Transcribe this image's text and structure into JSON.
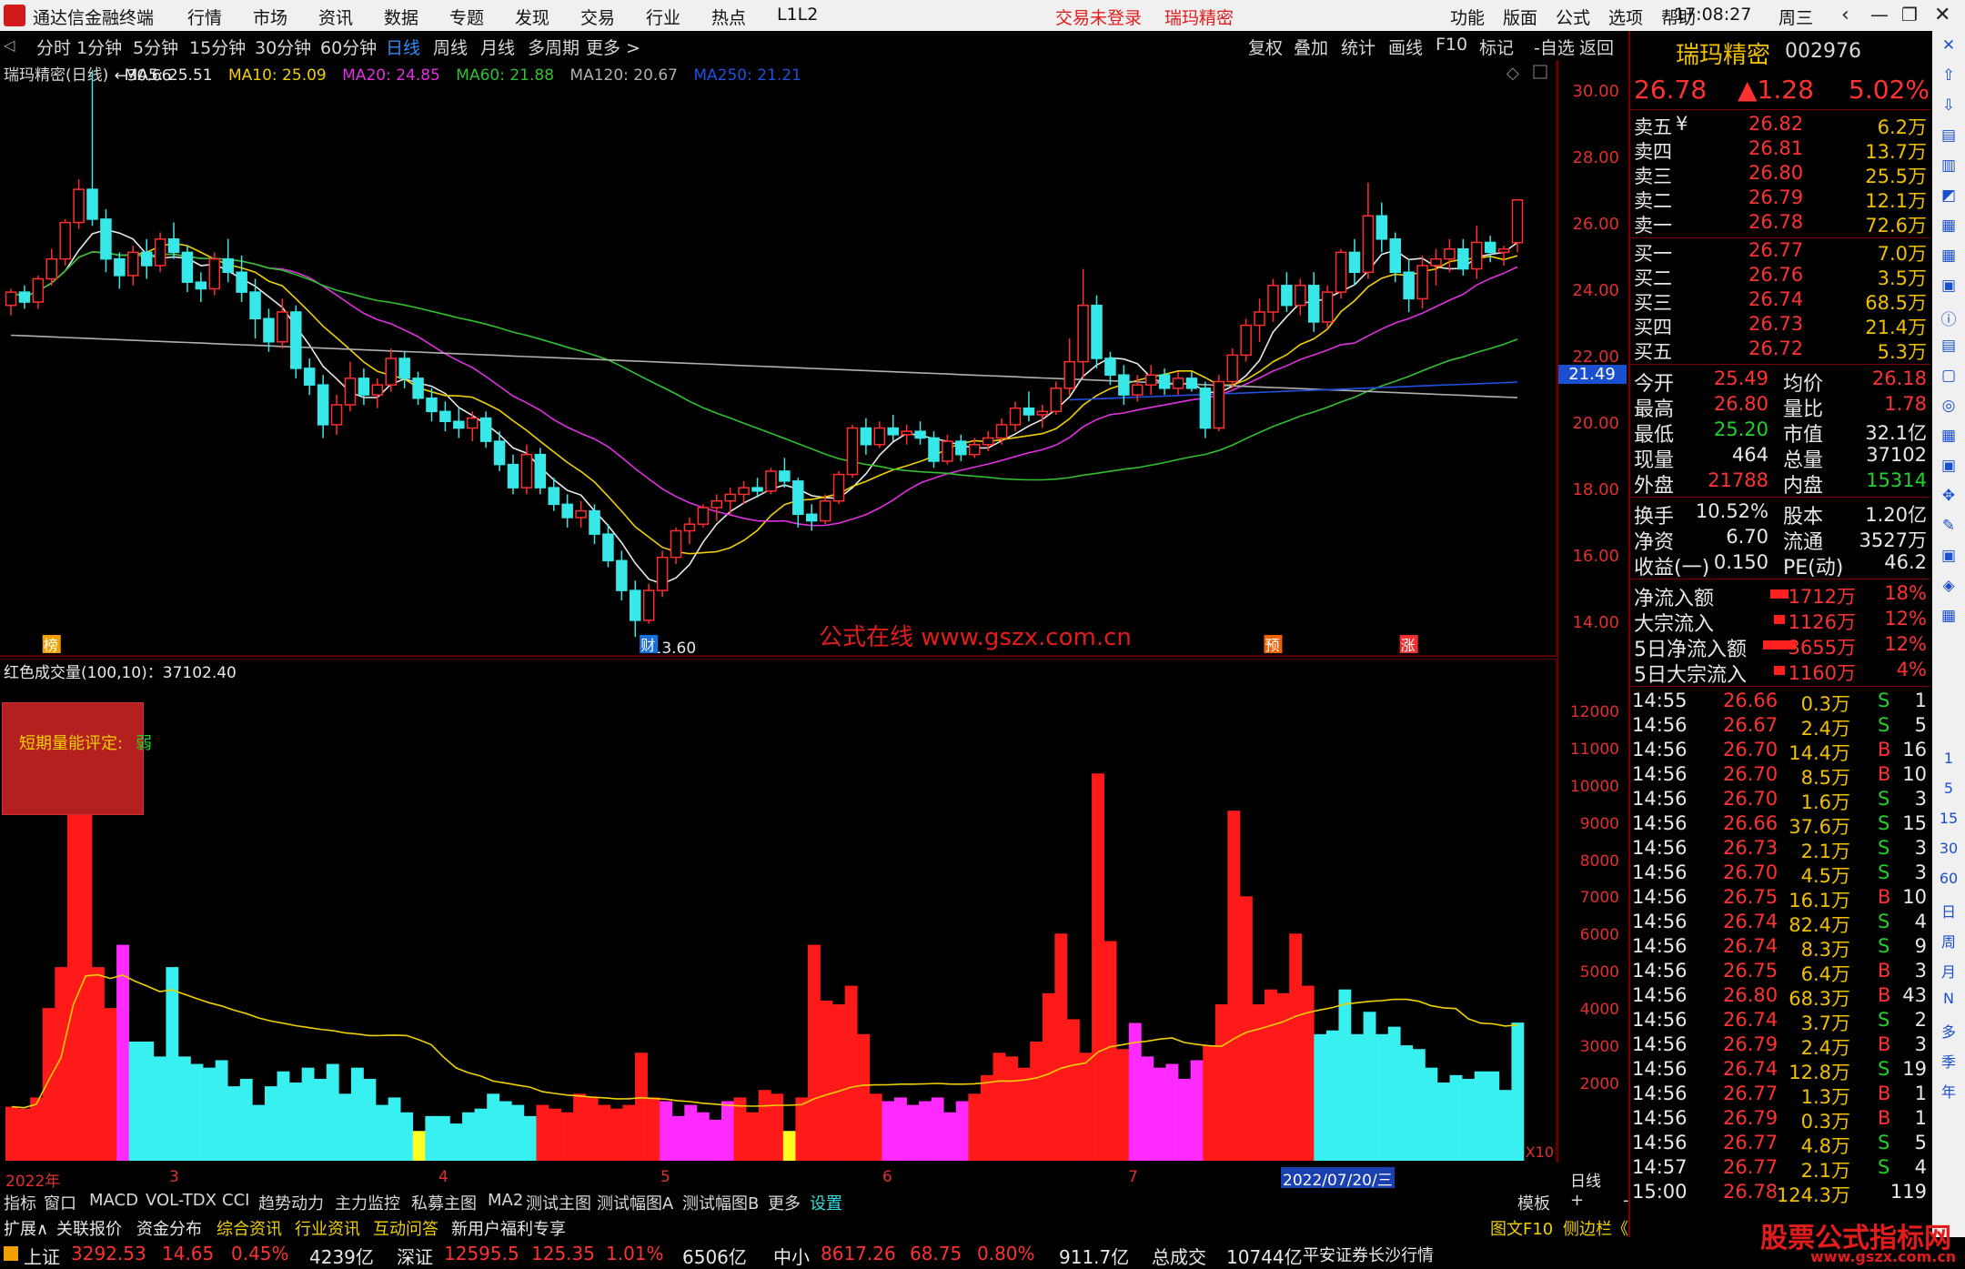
{
  "titlebar": {
    "app_name": "通达信金融终端",
    "menus": [
      "行情",
      "市场",
      "资讯",
      "数据",
      "专题",
      "发现",
      "交易",
      "行业",
      "热点",
      "L1L2"
    ],
    "status": "交易未登录",
    "stock": "瑞玛精密",
    "right_menus": [
      "功能",
      "版面",
      "公式",
      "选项",
      "帮助"
    ],
    "time": "17:08:27",
    "weekday": "周三"
  },
  "periods": [
    "分时",
    "1分钟",
    "5分钟",
    "15分钟",
    "30分钟",
    "60分钟",
    "日线",
    "周线",
    "月线",
    "多周期",
    "更多 >"
  ],
  "active_period": "日线",
  "tools": [
    "复权",
    "叠加",
    "统计",
    "画线",
    "F10",
    "标记",
    "-自选",
    "返回"
  ],
  "chart_header": {
    "name": "瑞玛精密(日线)",
    "ma5": "MA5: 25.51",
    "ma10": "MA10: 25.09",
    "ma20": "MA20: 24.85",
    "ma60": "MA60: 21.88",
    "ma120": "MA120: 20.67",
    "ma250": "MA250: 21.21"
  },
  "price_axis": [
    "30.00",
    "28.00",
    "26.00",
    "24.00",
    "22.00",
    "20.00",
    "18.00",
    "16.00",
    "14.00"
  ],
  "price_annotations": {
    "high": "30.66",
    "low": "13.60",
    "current_line": "21.49"
  },
  "markers": [
    "榜",
    "财",
    "预",
    "涨"
  ],
  "volume_header": "红色成交量(100,10)：37102.40",
  "volume_axis": [
    "12000",
    "11000",
    "10000",
    "9000",
    "8000",
    "7000",
    "6000",
    "5000",
    "4000",
    "3000",
    "2000"
  ],
  "volume_unit": "X10",
  "rating": {
    "label": "短期量能评定:",
    "value": "弱"
  },
  "x_axis": {
    "labels": [
      "2022年",
      "3",
      "4",
      "5",
      "6",
      "7"
    ],
    "cursor_date": "2022/07/20/三",
    "period": "日线"
  },
  "watermark": "公式在线  www.gszx.com.cn",
  "bottom_tabs": [
    "指标",
    "窗口",
    "MACD",
    "VOL-TDX",
    "CCI",
    "趋势动力",
    "主力监控",
    "私募主图",
    "MA2",
    "测试主图",
    "测试幅图A",
    "测试幅图B",
    "更多",
    "设置"
  ],
  "bottom_tabs_right": [
    "模板",
    "+",
    "-"
  ],
  "infobar": [
    "扩展∧",
    "关联报价",
    "资金分布",
    "综合资讯",
    "行业资讯",
    "互动问答",
    "新用户福利专享"
  ],
  "infobar_right": [
    "图文F10",
    "侧边栏《",
    "笔",
    "价",
    "细",
    "势"
  ],
  "tickers": {
    "sh": {
      "name": "上证",
      "value": "3292.53",
      "change": "14.65",
      "pct": "0.45%",
      "amount": "4239亿"
    },
    "sz": {
      "name": "深证",
      "value": "12595.5",
      "change": "125.35",
      "pct": "1.01%",
      "amount": "6506亿"
    },
    "zx": {
      "name": "中小",
      "value": "8617.26",
      "change": "68.75",
      "pct": "0.80%",
      "amount": "911.7亿"
    },
    "total": {
      "label": "总成交",
      "value": "10744亿",
      "broker": "平安证券长沙行情"
    }
  },
  "quote": {
    "name": "瑞玛精密",
    "code": "002976",
    "price": "26.78",
    "change": "▲1.28",
    "pct": "5.02%",
    "asks": [
      {
        "label": "卖五",
        "flag": "¥",
        "price": "26.82",
        "vol": "6.2万"
      },
      {
        "label": "卖四",
        "flag": "",
        "price": "26.81",
        "vol": "13.7万"
      },
      {
        "label": "卖三",
        "flag": "",
        "price": "26.80",
        "vol": "25.5万"
      },
      {
        "label": "卖二",
        "flag": "",
        "price": "26.79",
        "vol": "12.1万"
      },
      {
        "label": "卖一",
        "flag": "",
        "price": "26.78",
        "vol": "72.6万"
      }
    ],
    "bids": [
      {
        "label": "买一",
        "price": "26.77",
        "vol": "7.0万"
      },
      {
        "label": "买二",
        "price": "26.76",
        "vol": "3.5万"
      },
      {
        "label": "买三",
        "price": "26.74",
        "vol": "68.5万"
      },
      {
        "label": "买四",
        "price": "26.73",
        "vol": "21.4万"
      },
      {
        "label": "买五",
        "price": "26.72",
        "vol": "5.3万"
      }
    ],
    "stats1": [
      {
        "k1": "今开",
        "v1": "25.49",
        "k2": "均价",
        "v2": "26.18"
      },
      {
        "k1": "最高",
        "v1": "26.80",
        "k2": "量比",
        "v2": "1.78"
      },
      {
        "k1": "最低",
        "v1": "25.20",
        "k2": "市值",
        "v2": "32.1亿"
      },
      {
        "k1": "现量",
        "v1": "464",
        "k2": "总量",
        "v2": "37102"
      },
      {
        "k1": "外盘",
        "v1": "21788",
        "k2": "内盘",
        "v2": "15314"
      }
    ],
    "stats2": [
      {
        "k1": "换手",
        "v1": "10.52%",
        "k2": "股本",
        "v2": "1.20亿"
      },
      {
        "k1": "净资",
        "v1": "6.70",
        "k2": "流通",
        "v2": "3527万"
      },
      {
        "k1": "收益(一)",
        "v1": "0.150",
        "k2": "PE(动)",
        "v2": "46.2"
      }
    ],
    "flows": [
      {
        "label": "净流入额",
        "value": "1712万",
        "pct": "18%"
      },
      {
        "label": "大宗流入",
        "value": "1126万",
        "pct": "12%"
      },
      {
        "label": "5日净流入额",
        "value": "3655万",
        "pct": "12%"
      },
      {
        "label": "5日大宗流入",
        "value": "1160万",
        "pct": "4%"
      }
    ],
    "ticks": [
      {
        "t": "14:55",
        "p": "26.66",
        "v": "0.3万",
        "s": "S",
        "n": "1"
      },
      {
        "t": "14:56",
        "p": "26.67",
        "v": "2.4万",
        "s": "S",
        "n": "5"
      },
      {
        "t": "14:56",
        "p": "26.70",
        "v": "14.4万",
        "s": "B",
        "n": "16"
      },
      {
        "t": "14:56",
        "p": "26.70",
        "v": "8.5万",
        "s": "B",
        "n": "10"
      },
      {
        "t": "14:56",
        "p": "26.70",
        "v": "1.6万",
        "s": "S",
        "n": "3"
      },
      {
        "t": "14:56",
        "p": "26.66",
        "v": "37.6万",
        "s": "S",
        "n": "15"
      },
      {
        "t": "14:56",
        "p": "26.73",
        "v": "2.1万",
        "s": "S",
        "n": "3"
      },
      {
        "t": "14:56",
        "p": "26.70",
        "v": "4.5万",
        "s": "S",
        "n": "3"
      },
      {
        "t": "14:56",
        "p": "26.75",
        "v": "16.1万",
        "s": "B",
        "n": "10"
      },
      {
        "t": "14:56",
        "p": "26.74",
        "v": "82.4万",
        "s": "S",
        "n": "4"
      },
      {
        "t": "14:56",
        "p": "26.74",
        "v": "8.3万",
        "s": "S",
        "n": "9"
      },
      {
        "t": "14:56",
        "p": "26.75",
        "v": "6.4万",
        "s": "B",
        "n": "3"
      },
      {
        "t": "14:56",
        "p": "26.80",
        "v": "68.3万",
        "s": "B",
        "n": "43"
      },
      {
        "t": "14:56",
        "p": "26.74",
        "v": "3.7万",
        "s": "S",
        "n": "2"
      },
      {
        "t": "14:56",
        "p": "26.79",
        "v": "2.4万",
        "s": "B",
        "n": "3"
      },
      {
        "t": "14:56",
        "p": "26.74",
        "v": "12.8万",
        "s": "S",
        "n": "19"
      },
      {
        "t": "14:56",
        "p": "26.77",
        "v": "1.3万",
        "s": "B",
        "n": "1"
      },
      {
        "t": "14:56",
        "p": "26.79",
        "v": "0.3万",
        "s": "B",
        "n": "1"
      },
      {
        "t": "14:56",
        "p": "26.77",
        "v": "4.8万",
        "s": "S",
        "n": "5"
      },
      {
        "t": "14:57",
        "p": "26.77",
        "v": "2.1万",
        "s": "S",
        "n": "4"
      },
      {
        "t": "15:00",
        "p": "26.78",
        "v": "124.3万",
        "s": "",
        "n": "119"
      }
    ]
  },
  "sidebar_icons": [
    "close-icon",
    "up-icon",
    "down-icon",
    "quote-icon",
    "list-icon",
    "chart-icon",
    "kline-icon",
    "table-icon",
    "f10-icon",
    "info-icon",
    "notes-icon",
    "f2-icon",
    "circle-icon",
    "grid-icon",
    "rsi-icon",
    "move-icon",
    "pen-icon",
    "fs-icon",
    "share-icon",
    "period-icons"
  ],
  "sidebar_periods": [
    "1",
    "5",
    "15",
    "30",
    "60",
    "日",
    "周",
    "月",
    "N",
    "多",
    "季",
    "年"
  ],
  "brand_watermark": "股票公式指标网",
  "brand_url": "www.gszx.com.cn",
  "candles": [
    [
      23.6,
      24.1,
      23.3,
      24.0
    ],
    [
      24.0,
      24.2,
      23.5,
      23.7
    ],
    [
      23.7,
      24.5,
      23.5,
      24.4
    ],
    [
      24.4,
      25.3,
      24.2,
      25.0
    ],
    [
      25.0,
      26.2,
      24.8,
      26.1
    ],
    [
      26.1,
      27.4,
      25.9,
      27.1
    ],
    [
      27.1,
      30.66,
      26.0,
      26.2
    ],
    [
      26.2,
      26.5,
      24.6,
      25.0
    ],
    [
      25.0,
      25.2,
      24.1,
      24.5
    ],
    [
      24.5,
      25.4,
      24.2,
      25.2
    ],
    [
      25.2,
      25.6,
      24.4,
      24.8
    ],
    [
      24.8,
      25.8,
      24.6,
      25.6
    ],
    [
      25.6,
      26.1,
      25.0,
      25.2
    ],
    [
      25.2,
      25.4,
      24.0,
      24.3
    ],
    [
      24.3,
      24.6,
      23.7,
      24.1
    ],
    [
      24.1,
      25.2,
      23.9,
      25.0
    ],
    [
      25.0,
      25.6,
      24.3,
      24.6
    ],
    [
      24.6,
      25.1,
      23.7,
      24.0
    ],
    [
      24.0,
      24.4,
      22.6,
      23.2
    ],
    [
      23.2,
      23.5,
      22.2,
      22.5
    ],
    [
      22.5,
      23.8,
      22.3,
      23.4
    ],
    [
      23.4,
      23.6,
      21.4,
      21.7
    ],
    [
      21.7,
      22.0,
      20.9,
      21.2
    ],
    [
      21.2,
      21.5,
      19.6,
      20.0
    ],
    [
      20.0,
      20.9,
      19.7,
      20.6
    ],
    [
      20.6,
      21.9,
      20.4,
      21.4
    ],
    [
      21.4,
      21.7,
      20.6,
      20.9
    ],
    [
      20.9,
      21.4,
      20.5,
      21.2
    ],
    [
      21.2,
      22.3,
      21.0,
      22.0
    ],
    [
      22.0,
      22.2,
      21.1,
      21.4
    ],
    [
      21.4,
      21.6,
      20.6,
      20.8
    ],
    [
      20.8,
      21.1,
      20.1,
      20.4
    ],
    [
      20.4,
      20.7,
      19.8,
      20.1
    ],
    [
      20.1,
      20.5,
      19.6,
      19.9
    ],
    [
      19.9,
      20.4,
      19.5,
      20.2
    ],
    [
      20.2,
      20.4,
      19.3,
      19.5
    ],
    [
      19.5,
      19.8,
      18.6,
      18.8
    ],
    [
      18.8,
      19.1,
      17.9,
      18.1
    ],
    [
      18.1,
      19.4,
      17.9,
      19.1
    ],
    [
      19.1,
      19.3,
      17.9,
      18.1
    ],
    [
      18.1,
      18.4,
      17.4,
      17.6
    ],
    [
      17.6,
      17.9,
      16.9,
      17.2
    ],
    [
      17.2,
      17.7,
      16.9,
      17.4
    ],
    [
      17.4,
      17.6,
      16.4,
      16.7
    ],
    [
      16.7,
      17.0,
      15.7,
      15.9
    ],
    [
      15.9,
      16.2,
      14.7,
      15.0
    ],
    [
      15.0,
      15.3,
      13.6,
      14.1
    ],
    [
      14.1,
      15.2,
      14.0,
      15.0
    ],
    [
      15.0,
      16.2,
      14.8,
      16.0
    ],
    [
      16.0,
      16.9,
      15.8,
      16.8
    ],
    [
      16.8,
      17.2,
      16.4,
      17.0
    ],
    [
      17.0,
      17.6,
      16.9,
      17.5
    ],
    [
      17.5,
      17.9,
      17.1,
      17.7
    ],
    [
      17.7,
      18.1,
      17.3,
      17.9
    ],
    [
      17.9,
      18.3,
      17.6,
      18.1
    ],
    [
      18.1,
      18.4,
      17.8,
      18.0
    ],
    [
      18.0,
      18.7,
      17.9,
      18.6
    ],
    [
      18.6,
      19.0,
      18.1,
      18.3
    ],
    [
      18.3,
      18.4,
      16.9,
      17.3
    ],
    [
      17.3,
      17.6,
      16.8,
      17.1
    ],
    [
      17.1,
      17.9,
      17.0,
      17.7
    ],
    [
      17.7,
      18.6,
      17.6,
      18.5
    ],
    [
      18.5,
      20.0,
      18.4,
      19.9
    ],
    [
      19.9,
      20.2,
      19.1,
      19.4
    ],
    [
      19.4,
      20.1,
      19.3,
      19.9
    ],
    [
      19.9,
      20.3,
      19.5,
      19.7
    ],
    [
      19.7,
      20.0,
      19.4,
      19.8
    ],
    [
      19.8,
      20.1,
      19.4,
      19.6
    ],
    [
      19.6,
      19.8,
      18.7,
      18.9
    ],
    [
      18.9,
      19.7,
      18.8,
      19.5
    ],
    [
      19.5,
      19.7,
      18.9,
      19.1
    ],
    [
      19.1,
      19.6,
      19.0,
      19.4
    ],
    [
      19.4,
      19.8,
      19.2,
      19.6
    ],
    [
      19.6,
      20.2,
      19.4,
      20.0
    ],
    [
      20.0,
      20.7,
      19.8,
      20.5
    ],
    [
      20.5,
      21.0,
      20.1,
      20.3
    ],
    [
      20.3,
      20.6,
      19.9,
      20.4
    ],
    [
      20.4,
      21.3,
      20.3,
      21.1
    ],
    [
      21.1,
      22.6,
      20.9,
      21.9
    ],
    [
      21.9,
      24.7,
      21.4,
      23.6
    ],
    [
      23.6,
      23.9,
      21.7,
      22.0
    ],
    [
      22.0,
      22.2,
      21.2,
      21.5
    ],
    [
      21.5,
      21.8,
      20.6,
      20.9
    ],
    [
      20.9,
      21.5,
      20.7,
      21.2
    ],
    [
      21.2,
      21.8,
      20.9,
      21.5
    ],
    [
      21.5,
      21.7,
      20.9,
      21.1
    ],
    [
      21.1,
      21.6,
      20.9,
      21.4
    ],
    [
      21.4,
      21.6,
      21.0,
      21.1
    ],
    [
      21.1,
      21.3,
      19.6,
      19.9
    ],
    [
      19.9,
      21.5,
      19.8,
      21.3
    ],
    [
      21.3,
      22.3,
      21.1,
      22.1
    ],
    [
      22.1,
      23.2,
      21.9,
      23.0
    ],
    [
      23.0,
      23.8,
      22.5,
      23.4
    ],
    [
      23.4,
      24.4,
      23.1,
      24.2
    ],
    [
      24.2,
      24.6,
      23.4,
      23.6
    ],
    [
      23.6,
      24.4,
      23.3,
      24.2
    ],
    [
      24.2,
      24.6,
      22.8,
      23.1
    ],
    [
      23.1,
      24.2,
      22.9,
      24.0
    ],
    [
      24.0,
      25.3,
      23.8,
      25.2
    ],
    [
      25.2,
      25.6,
      24.2,
      24.6
    ],
    [
      24.6,
      27.3,
      24.4,
      26.3
    ],
    [
      26.3,
      26.7,
      25.2,
      25.6
    ],
    [
      25.6,
      25.8,
      24.3,
      24.6
    ],
    [
      24.6,
      25.0,
      23.4,
      23.8
    ],
    [
      23.8,
      25.1,
      23.5,
      24.8
    ],
    [
      24.8,
      25.3,
      24.2,
      25.0
    ],
    [
      25.0,
      25.6,
      24.6,
      25.3
    ],
    [
      25.3,
      25.6,
      24.5,
      24.7
    ],
    [
      24.7,
      26.0,
      24.4,
      25.5
    ],
    [
      25.5,
      25.7,
      24.9,
      25.2
    ],
    [
      25.2,
      25.4,
      24.8,
      25.3
    ],
    [
      25.49,
      26.8,
      25.2,
      26.78
    ]
  ],
  "volumes": [
    [
      1450,
      "red"
    ],
    [
      1400,
      "red"
    ],
    [
      1700,
      "red"
    ],
    [
      4100,
      "red"
    ],
    [
      5200,
      "red"
    ],
    [
      11300,
      "red"
    ],
    [
      9600,
      "red"
    ],
    [
      5200,
      "red"
    ],
    [
      4100,
      "red"
    ],
    [
      5800,
      "magenta"
    ],
    [
      3200,
      "cyan"
    ],
    [
      3200,
      "cyan"
    ],
    [
      2800,
      "cyan"
    ],
    [
      5200,
      "cyan"
    ],
    [
      2800,
      "cyan"
    ],
    [
      2600,
      "cyan"
    ],
    [
      2500,
      "cyan"
    ],
    [
      2700,
      "cyan"
    ],
    [
      2000,
      "cyan"
    ],
    [
      2200,
      "cyan"
    ],
    [
      1500,
      "cyan"
    ],
    [
      2000,
      "cyan"
    ],
    [
      2400,
      "cyan"
    ],
    [
      2100,
      "cyan"
    ],
    [
      2500,
      "cyan"
    ],
    [
      2200,
      "cyan"
    ],
    [
      2600,
      "cyan"
    ],
    [
      1800,
      "cyan"
    ],
    [
      2500,
      "cyan"
    ],
    [
      2200,
      "cyan"
    ],
    [
      1500,
      "cyan"
    ],
    [
      1700,
      "cyan"
    ],
    [
      1300,
      "cyan"
    ],
    [
      800,
      "yellow"
    ],
    [
      1200,
      "cyan"
    ],
    [
      1200,
      "cyan"
    ],
    [
      1000,
      "cyan"
    ],
    [
      1300,
      "cyan"
    ],
    [
      1400,
      "cyan"
    ],
    [
      1800,
      "cyan"
    ],
    [
      1600,
      "cyan"
    ],
    [
      1500,
      "cyan"
    ],
    [
      1200,
      "cyan"
    ],
    [
      1500,
      "red"
    ],
    [
      1400,
      "red"
    ],
    [
      1300,
      "red"
    ],
    [
      1800,
      "red"
    ],
    [
      1700,
      "red"
    ],
    [
      1500,
      "red"
    ],
    [
      1400,
      "red"
    ],
    [
      1500,
      "red"
    ],
    [
      2900,
      "red"
    ],
    [
      1700,
      "red"
    ],
    [
      1600,
      "magenta"
    ],
    [
      1200,
      "magenta"
    ],
    [
      1500,
      "magenta"
    ],
    [
      1300,
      "magenta"
    ],
    [
      1100,
      "magenta"
    ],
    [
      1600,
      "magenta"
    ],
    [
      1700,
      "red"
    ],
    [
      1300,
      "red"
    ],
    [
      1900,
      "red"
    ],
    [
      1800,
      "red"
    ],
    [
      800,
      "yellow"
    ],
    [
      1700,
      "red"
    ],
    [
      5800,
      "red"
    ],
    [
      4300,
      "red"
    ],
    [
      4200,
      "red"
    ],
    [
      4700,
      "red"
    ],
    [
      3400,
      "red"
    ],
    [
      1800,
      "red"
    ],
    [
      1600,
      "magenta"
    ],
    [
      1700,
      "magenta"
    ],
    [
      1500,
      "magenta"
    ],
    [
      1600,
      "magenta"
    ],
    [
      1700,
      "magenta"
    ],
    [
      1300,
      "magenta"
    ],
    [
      1600,
      "magenta"
    ],
    [
      1800,
      "red"
    ],
    [
      2300,
      "red"
    ],
    [
      2900,
      "red"
    ],
    [
      2800,
      "red"
    ],
    [
      2500,
      "red"
    ],
    [
      3200,
      "red"
    ],
    [
      4500,
      "red"
    ],
    [
      6100,
      "red"
    ],
    [
      3800,
      "red"
    ],
    [
      2900,
      "red"
    ],
    [
      10400,
      "red"
    ],
    [
      5900,
      "red"
    ],
    [
      3000,
      "red"
    ],
    [
      3700,
      "magenta"
    ],
    [
      2800,
      "magenta"
    ],
    [
      2500,
      "magenta"
    ],
    [
      2600,
      "magenta"
    ],
    [
      2200,
      "magenta"
    ],
    [
      2700,
      "magenta"
    ],
    [
      3100,
      "red"
    ],
    [
      4200,
      "red"
    ],
    [
      9400,
      "red"
    ],
    [
      7100,
      "red"
    ],
    [
      4200,
      "red"
    ],
    [
      4600,
      "red"
    ],
    [
      4500,
      "red"
    ],
    [
      6100,
      "red"
    ],
    [
      4700,
      "red"
    ],
    [
      3400,
      "cyan"
    ],
    [
      3500,
      "cyan"
    ],
    [
      4600,
      "cyan"
    ],
    [
      3400,
      "cyan"
    ],
    [
      4000,
      "cyan"
    ],
    [
      3400,
      "cyan"
    ],
    [
      3600,
      "cyan"
    ],
    [
      3100,
      "cyan"
    ],
    [
      3000,
      "cyan"
    ],
    [
      2500,
      "cyan"
    ],
    [
      2100,
      "cyan"
    ],
    [
      2300,
      "cyan"
    ],
    [
      2200,
      "cyan"
    ],
    [
      2400,
      "cyan"
    ],
    [
      2400,
      "cyan"
    ],
    [
      1900,
      "cyan"
    ],
    [
      3710,
      "cyan"
    ]
  ],
  "colors": {
    "up": "#ff2d2d",
    "down": "#38e8e8",
    "ma5": "#e8e8e8",
    "ma10": "#f0d000",
    "ma20": "#e030e0",
    "ma60": "#30c030",
    "ma120": "#b0b0b0",
    "ma250": "#2050e0",
    "grid": "#5a0000"
  }
}
